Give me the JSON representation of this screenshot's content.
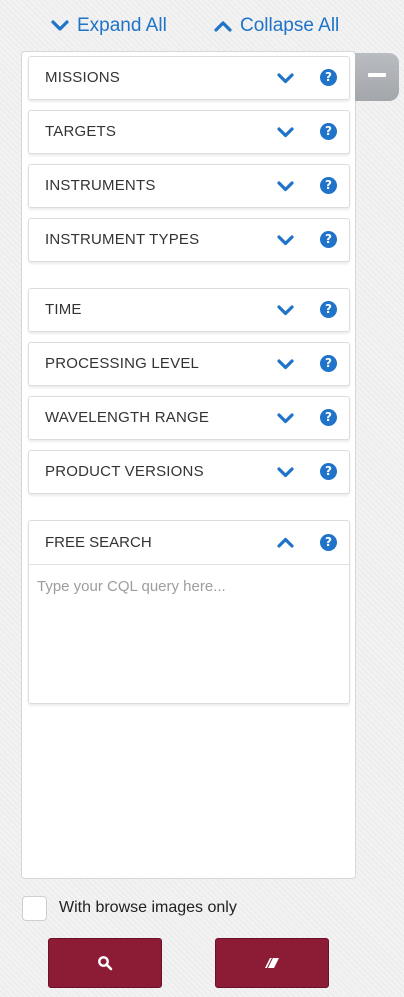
{
  "top_links": {
    "expand_all": "Expand All",
    "collapse_all": "Collapse All"
  },
  "sections": [
    {
      "label": "MISSIONS",
      "state": "collapsed"
    },
    {
      "label": "TARGETS",
      "state": "collapsed"
    },
    {
      "label": "INSTRUMENTS",
      "state": "collapsed"
    },
    {
      "label": "INSTRUMENT TYPES",
      "state": "collapsed"
    },
    {
      "label": "TIME",
      "state": "collapsed"
    },
    {
      "label": "PROCESSING LEVEL",
      "state": "collapsed"
    },
    {
      "label": "WAVELENGTH RANGE",
      "state": "collapsed"
    },
    {
      "label": "PRODUCT VERSIONS",
      "state": "collapsed"
    }
  ],
  "free_search": {
    "label": "FREE SEARCH",
    "state": "expanded",
    "value": "",
    "placeholder": "Type your CQL query here..."
  },
  "browse_option": {
    "label": "With browse images only",
    "checked": false
  },
  "icons": {
    "expand": "chevron-down-icon",
    "collapse": "chevron-up-icon",
    "help": "question-circle-icon",
    "hide_panel": "minus-icon",
    "search": "magnifier-icon",
    "clear": "eraser-icon"
  },
  "colors": {
    "accent_blue": "#1f73c8",
    "button_red": "#8c1b36",
    "tab_grey": "#a9acb0"
  }
}
